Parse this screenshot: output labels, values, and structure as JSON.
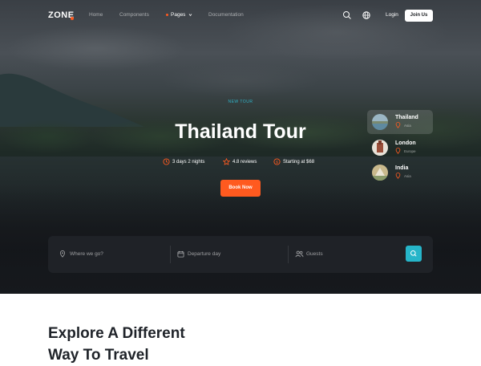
{
  "nav": {
    "logo": "ZONE",
    "links": [
      "Home",
      "Components",
      "Pages",
      "Documentation"
    ],
    "login_label": "Login",
    "join_label": "Join Us"
  },
  "hero": {
    "kicker": "NEW TOUR",
    "title": "Thailand Tour",
    "duration": "3 days 2 nights",
    "reviews": "4.8 reviews",
    "price": "Starting at $68",
    "cta_label": "Book Now"
  },
  "destinations": [
    {
      "name": "Thailand",
      "location": "Asia",
      "active": true
    },
    {
      "name": "London",
      "location": "Europe",
      "active": false
    },
    {
      "name": "India",
      "location": "Asia",
      "active": false
    }
  ],
  "search": {
    "where_placeholder": "Where we go?",
    "date_placeholder": "Departure day",
    "guests_placeholder": "Guests"
  },
  "section": {
    "heading_line1": "Explore A Different",
    "heading_line2": "Way To Travel"
  },
  "colors": {
    "accent": "#ff5a1f",
    "teal": "#26b5c9"
  }
}
